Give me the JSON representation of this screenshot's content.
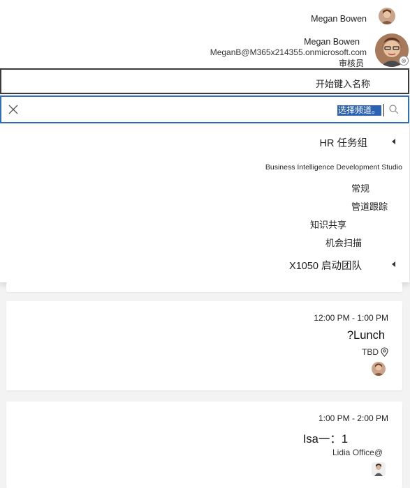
{
  "header": {
    "user_name": "Megan Bowen"
  },
  "profile": {
    "name": "Megan Bowen",
    "email": "MeganB@M365x214355.onmicrosoft.com",
    "role": "审核员",
    "presence_icon": "⊗"
  },
  "name_field": {
    "placeholder": "开始键入名称"
  },
  "channel_search": {
    "value": "选择频道。",
    "placeholder": "选择频道。"
  },
  "dropdown": {
    "items": [
      {
        "label": "HR 任务组",
        "type": "group"
      },
      {
        "label": "Business Intelligence Development Studio",
        "type": "item"
      },
      {
        "label": "常规",
        "type": "item"
      },
      {
        "label": "管道跟踪",
        "type": "item"
      },
      {
        "label": "知识共享",
        "type": "item"
      },
      {
        "label": "机会扫描",
        "type": "item"
      },
      {
        "label": "X1050 启动团队",
        "type": "group"
      }
    ]
  },
  "events": [
    {
      "time": "12:00 PM - 1:00 PM",
      "title": "?Lunch",
      "location": "TBD"
    },
    {
      "time": "1:00 PM - 2:00 PM",
      "title": "Isa一：1",
      "location": "Lidia Office@"
    }
  ],
  "colors": {
    "accent_blue": "#2f6fb8",
    "selection_blue": "#2b62b3",
    "page_bg": "#f3f3f3"
  }
}
